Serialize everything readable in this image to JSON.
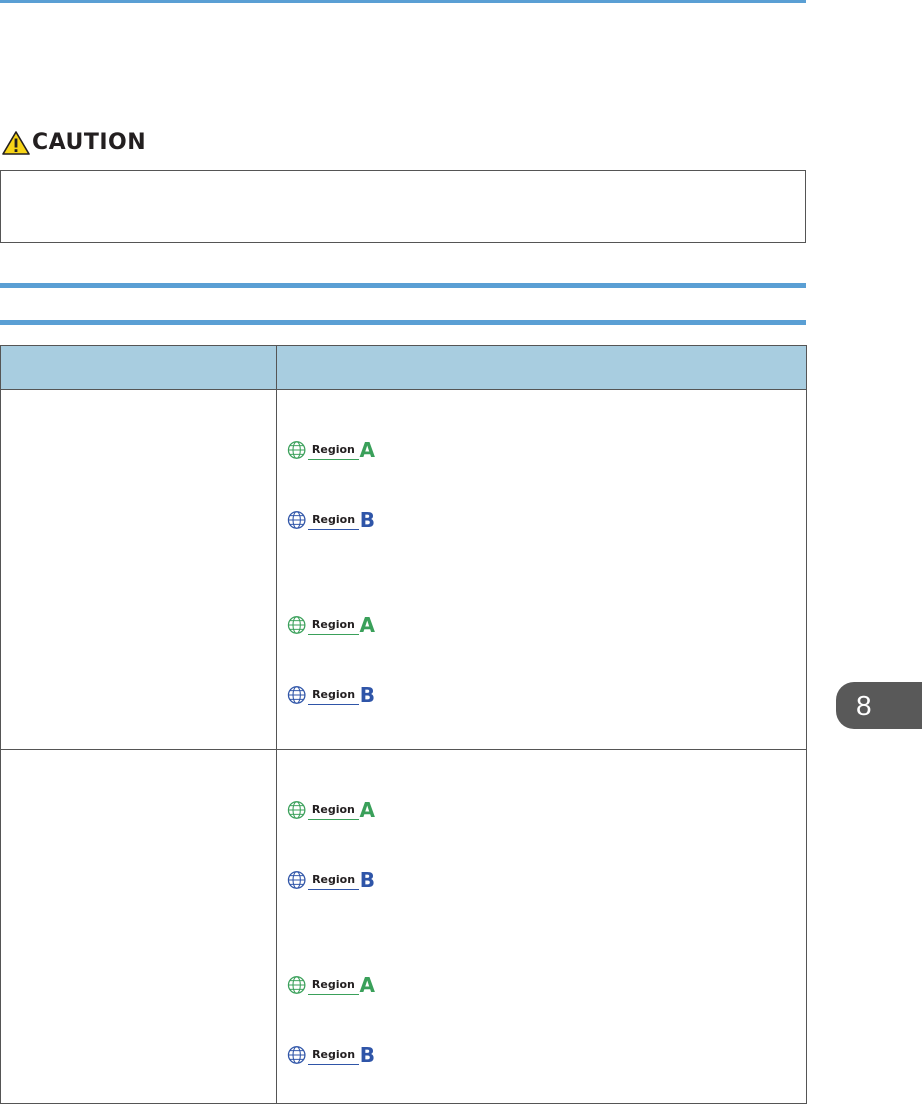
{
  "caution": {
    "label": "CAUTION",
    "icon": "warning-triangle-icon"
  },
  "table": {
    "rows": [
      {
        "badges": [
          {
            "label": "Region",
            "letter": "A",
            "color": "#3aa05a"
          },
          {
            "label": "Region",
            "letter": "B",
            "color": "#2f55a8"
          },
          {
            "label": "Region",
            "letter": "A",
            "color": "#3aa05a"
          },
          {
            "label": "Region",
            "letter": "B",
            "color": "#2f55a8"
          }
        ]
      },
      {
        "badges": [
          {
            "label": "Region",
            "letter": "A",
            "color": "#3aa05a"
          },
          {
            "label": "Region",
            "letter": "B",
            "color": "#2f55a8"
          },
          {
            "label": "Region",
            "letter": "A",
            "color": "#3aa05a"
          },
          {
            "label": "Region",
            "letter": "B",
            "color": "#2f55a8"
          }
        ]
      }
    ]
  },
  "chapter_tab": {
    "number": "8"
  },
  "colors": {
    "accent_rule": "#5a9fd4",
    "table_header": "#a8cde0",
    "tab_background": "#595959",
    "region_a": "#3aa05a",
    "region_b": "#2f55a8"
  }
}
